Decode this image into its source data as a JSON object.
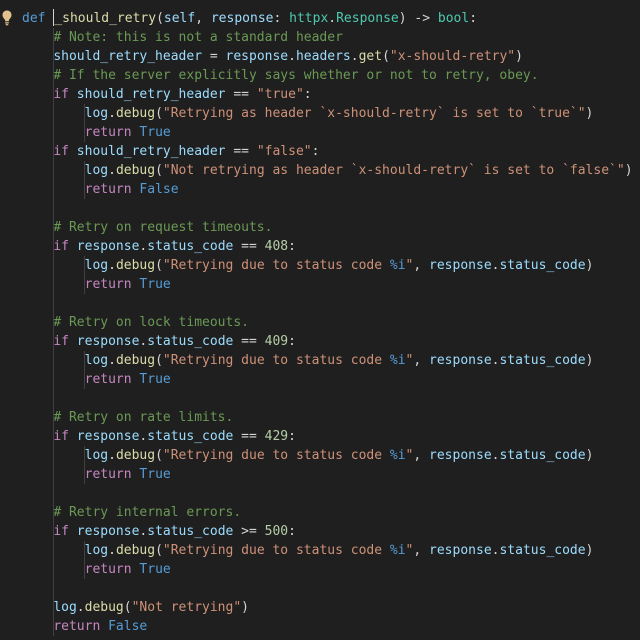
{
  "editor": {
    "language": "python",
    "theme_colors": {
      "background": "#1f1f1f",
      "keyword": "#569cd6",
      "control": "#c586c0",
      "function": "#dcdcaa",
      "variable": "#9cdcfe",
      "type": "#4ec9b0",
      "string": "#ce9178",
      "comment": "#6a9955",
      "number": "#b5cea8",
      "plain": "#d4d4d4"
    },
    "gutter_icon": "lightbulb-icon",
    "lines": [
      {
        "indent": 0,
        "tokens": [
          [
            "kw",
            "def"
          ],
          [
            "pl",
            " "
          ],
          [
            "cursor",
            ""
          ],
          [
            "fn",
            "_should_retry"
          ],
          [
            "pl",
            "("
          ],
          [
            "var",
            "self"
          ],
          [
            "pl",
            ", "
          ],
          [
            "var",
            "response"
          ],
          [
            "pl",
            ": "
          ],
          [
            "typ",
            "httpx"
          ],
          [
            "pl",
            "."
          ],
          [
            "typ",
            "Response"
          ],
          [
            "pl",
            ") -> "
          ],
          [
            "typ",
            "bool"
          ],
          [
            "pl",
            ":"
          ]
        ]
      },
      {
        "indent": 1,
        "tokens": [
          [
            "cmt",
            "# Note: this is not a standard header"
          ]
        ]
      },
      {
        "indent": 1,
        "tokens": [
          [
            "var",
            "should_retry_header"
          ],
          [
            "pl",
            " = "
          ],
          [
            "var",
            "response"
          ],
          [
            "pl",
            "."
          ],
          [
            "var",
            "headers"
          ],
          [
            "pl",
            "."
          ],
          [
            "fn",
            "get"
          ],
          [
            "pl",
            "("
          ],
          [
            "str",
            "\"x-should-retry\""
          ],
          [
            "pl",
            ")"
          ]
        ]
      },
      {
        "indent": 1,
        "tokens": [
          [
            "cmt",
            "# If the server explicitly says whether or not to retry, obey."
          ]
        ]
      },
      {
        "indent": 1,
        "tokens": [
          [
            "ctl",
            "if"
          ],
          [
            "pl",
            " "
          ],
          [
            "var",
            "should_retry_header"
          ],
          [
            "pl",
            " == "
          ],
          [
            "str",
            "\"true\""
          ],
          [
            "pl",
            ":"
          ]
        ]
      },
      {
        "indent": 2,
        "tokens": [
          [
            "var",
            "log"
          ],
          [
            "pl",
            "."
          ],
          [
            "fn",
            "debug"
          ],
          [
            "pl",
            "("
          ],
          [
            "str",
            "\"Retrying as header `x-should-retry` is set to `true`\""
          ],
          [
            "pl",
            ")"
          ]
        ]
      },
      {
        "indent": 2,
        "tokens": [
          [
            "ctl",
            "return"
          ],
          [
            "pl",
            " "
          ],
          [
            "kw",
            "True"
          ]
        ]
      },
      {
        "indent": 1,
        "tokens": [
          [
            "ctl",
            "if"
          ],
          [
            "pl",
            " "
          ],
          [
            "var",
            "should_retry_header"
          ],
          [
            "pl",
            " == "
          ],
          [
            "str",
            "\"false\""
          ],
          [
            "pl",
            ":"
          ]
        ]
      },
      {
        "indent": 2,
        "tokens": [
          [
            "var",
            "log"
          ],
          [
            "pl",
            "."
          ],
          [
            "fn",
            "debug"
          ],
          [
            "pl",
            "("
          ],
          [
            "str",
            "\"Not retrying as header `x-should-retry` is set to `false`\""
          ],
          [
            "pl",
            ")"
          ]
        ]
      },
      {
        "indent": 2,
        "tokens": [
          [
            "ctl",
            "return"
          ],
          [
            "pl",
            " "
          ],
          [
            "kw",
            "False"
          ]
        ]
      },
      {
        "indent": 1,
        "tokens": []
      },
      {
        "indent": 1,
        "tokens": [
          [
            "cmt",
            "# Retry on request timeouts."
          ]
        ]
      },
      {
        "indent": 1,
        "tokens": [
          [
            "ctl",
            "if"
          ],
          [
            "pl",
            " "
          ],
          [
            "var",
            "response"
          ],
          [
            "pl",
            "."
          ],
          [
            "var",
            "status_code"
          ],
          [
            "pl",
            " == "
          ],
          [
            "num",
            "408"
          ],
          [
            "pl",
            ":"
          ]
        ]
      },
      {
        "indent": 2,
        "tokens": [
          [
            "var",
            "log"
          ],
          [
            "pl",
            "."
          ],
          [
            "fn",
            "debug"
          ],
          [
            "pl",
            "("
          ],
          [
            "str",
            "\"Retrying due to status code "
          ],
          [
            "kw",
            "%i"
          ],
          [
            "str",
            "\""
          ],
          [
            "pl",
            ", "
          ],
          [
            "var",
            "response"
          ],
          [
            "pl",
            "."
          ],
          [
            "var",
            "status_code"
          ],
          [
            "pl",
            ")"
          ]
        ]
      },
      {
        "indent": 2,
        "tokens": [
          [
            "ctl",
            "return"
          ],
          [
            "pl",
            " "
          ],
          [
            "kw",
            "True"
          ]
        ]
      },
      {
        "indent": 1,
        "tokens": []
      },
      {
        "indent": 1,
        "tokens": [
          [
            "cmt",
            "# Retry on lock timeouts."
          ]
        ]
      },
      {
        "indent": 1,
        "tokens": [
          [
            "ctl",
            "if"
          ],
          [
            "pl",
            " "
          ],
          [
            "var",
            "response"
          ],
          [
            "pl",
            "."
          ],
          [
            "var",
            "status_code"
          ],
          [
            "pl",
            " == "
          ],
          [
            "num",
            "409"
          ],
          [
            "pl",
            ":"
          ]
        ]
      },
      {
        "indent": 2,
        "tokens": [
          [
            "var",
            "log"
          ],
          [
            "pl",
            "."
          ],
          [
            "fn",
            "debug"
          ],
          [
            "pl",
            "("
          ],
          [
            "str",
            "\"Retrying due to status code "
          ],
          [
            "kw",
            "%i"
          ],
          [
            "str",
            "\""
          ],
          [
            "pl",
            ", "
          ],
          [
            "var",
            "response"
          ],
          [
            "pl",
            "."
          ],
          [
            "var",
            "status_code"
          ],
          [
            "pl",
            ")"
          ]
        ]
      },
      {
        "indent": 2,
        "tokens": [
          [
            "ctl",
            "return"
          ],
          [
            "pl",
            " "
          ],
          [
            "kw",
            "True"
          ]
        ]
      },
      {
        "indent": 1,
        "tokens": []
      },
      {
        "indent": 1,
        "tokens": [
          [
            "cmt",
            "# Retry on rate limits."
          ]
        ]
      },
      {
        "indent": 1,
        "tokens": [
          [
            "ctl",
            "if"
          ],
          [
            "pl",
            " "
          ],
          [
            "var",
            "response"
          ],
          [
            "pl",
            "."
          ],
          [
            "var",
            "status_code"
          ],
          [
            "pl",
            " == "
          ],
          [
            "num",
            "429"
          ],
          [
            "pl",
            ":"
          ]
        ]
      },
      {
        "indent": 2,
        "tokens": [
          [
            "var",
            "log"
          ],
          [
            "pl",
            "."
          ],
          [
            "fn",
            "debug"
          ],
          [
            "pl",
            "("
          ],
          [
            "str",
            "\"Retrying due to status code "
          ],
          [
            "kw",
            "%i"
          ],
          [
            "str",
            "\""
          ],
          [
            "pl",
            ", "
          ],
          [
            "var",
            "response"
          ],
          [
            "pl",
            "."
          ],
          [
            "var",
            "status_code"
          ],
          [
            "pl",
            ")"
          ]
        ]
      },
      {
        "indent": 2,
        "tokens": [
          [
            "ctl",
            "return"
          ],
          [
            "pl",
            " "
          ],
          [
            "kw",
            "True"
          ]
        ]
      },
      {
        "indent": 1,
        "tokens": []
      },
      {
        "indent": 1,
        "tokens": [
          [
            "cmt",
            "# Retry internal errors."
          ]
        ]
      },
      {
        "indent": 1,
        "tokens": [
          [
            "ctl",
            "if"
          ],
          [
            "pl",
            " "
          ],
          [
            "var",
            "response"
          ],
          [
            "pl",
            "."
          ],
          [
            "var",
            "status_code"
          ],
          [
            "pl",
            " >= "
          ],
          [
            "num",
            "500"
          ],
          [
            "pl",
            ":"
          ]
        ]
      },
      {
        "indent": 2,
        "tokens": [
          [
            "var",
            "log"
          ],
          [
            "pl",
            "."
          ],
          [
            "fn",
            "debug"
          ],
          [
            "pl",
            "("
          ],
          [
            "str",
            "\"Retrying due to status code "
          ],
          [
            "kw",
            "%i"
          ],
          [
            "str",
            "\""
          ],
          [
            "pl",
            ", "
          ],
          [
            "var",
            "response"
          ],
          [
            "pl",
            "."
          ],
          [
            "var",
            "status_code"
          ],
          [
            "pl",
            ")"
          ]
        ]
      },
      {
        "indent": 2,
        "tokens": [
          [
            "ctl",
            "return"
          ],
          [
            "pl",
            " "
          ],
          [
            "kw",
            "True"
          ]
        ]
      },
      {
        "indent": 1,
        "tokens": []
      },
      {
        "indent": 1,
        "tokens": [
          [
            "var",
            "log"
          ],
          [
            "pl",
            "."
          ],
          [
            "fn",
            "debug"
          ],
          [
            "pl",
            "("
          ],
          [
            "str",
            "\"Not retrying\""
          ],
          [
            "pl",
            ")"
          ]
        ]
      },
      {
        "indent": 1,
        "tokens": [
          [
            "ctl",
            "return"
          ],
          [
            "pl",
            " "
          ],
          [
            "kw",
            "False"
          ]
        ]
      }
    ]
  }
}
